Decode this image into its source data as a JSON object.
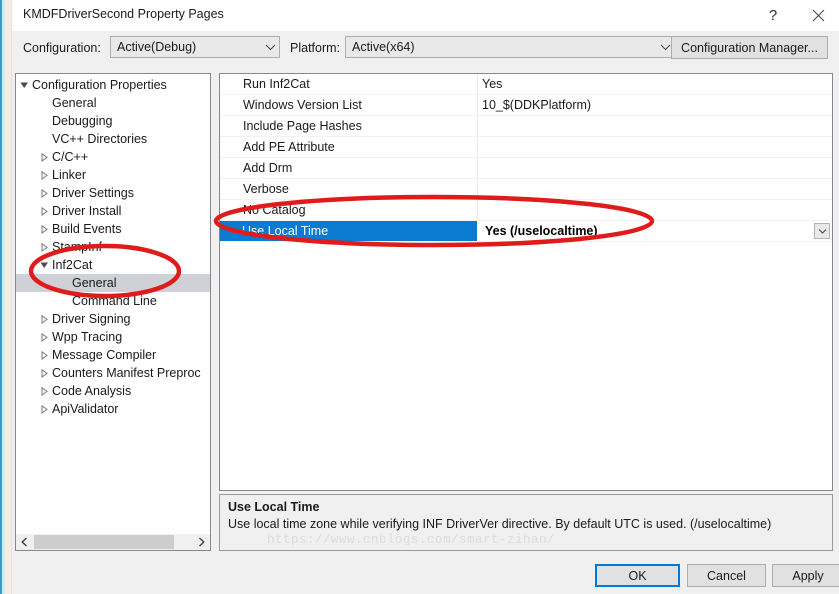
{
  "window": {
    "title": "KMDFDriverSecond Property Pages",
    "help_icon": "question-mark-icon",
    "close_icon": "close-icon"
  },
  "config_bar": {
    "configuration_label": "Configuration:",
    "configuration_value": "Active(Debug)",
    "platform_label": "Platform:",
    "platform_value": "Active(x64)",
    "configuration_manager_button": "Configuration Manager..."
  },
  "tree": {
    "items": [
      {
        "label": "Configuration Properties",
        "indent": 0,
        "toggle": "expanded",
        "selected": false
      },
      {
        "label": "General",
        "indent": 1,
        "toggle": "none",
        "selected": false
      },
      {
        "label": "Debugging",
        "indent": 1,
        "toggle": "none",
        "selected": false
      },
      {
        "label": "VC++ Directories",
        "indent": 1,
        "toggle": "none",
        "selected": false
      },
      {
        "label": "C/C++",
        "indent": 1,
        "toggle": "collapsed",
        "selected": false
      },
      {
        "label": "Linker",
        "indent": 1,
        "toggle": "collapsed",
        "selected": false
      },
      {
        "label": "Driver Settings",
        "indent": 1,
        "toggle": "collapsed",
        "selected": false
      },
      {
        "label": "Driver Install",
        "indent": 1,
        "toggle": "collapsed",
        "selected": false
      },
      {
        "label": "Build Events",
        "indent": 1,
        "toggle": "collapsed",
        "selected": false
      },
      {
        "label": "StampInf",
        "indent": 1,
        "toggle": "collapsed",
        "selected": false
      },
      {
        "label": "Inf2Cat",
        "indent": 1,
        "toggle": "expanded",
        "selected": false
      },
      {
        "label": "General",
        "indent": 2,
        "toggle": "none",
        "selected": true
      },
      {
        "label": "Command Line",
        "indent": 2,
        "toggle": "none",
        "selected": false
      },
      {
        "label": "Driver Signing",
        "indent": 1,
        "toggle": "collapsed",
        "selected": false
      },
      {
        "label": "Wpp Tracing",
        "indent": 1,
        "toggle": "collapsed",
        "selected": false
      },
      {
        "label": "Message Compiler",
        "indent": 1,
        "toggle": "collapsed",
        "selected": false
      },
      {
        "label": "Counters Manifest Preproc",
        "indent": 1,
        "toggle": "collapsed",
        "selected": false
      },
      {
        "label": "Code Analysis",
        "indent": 1,
        "toggle": "collapsed",
        "selected": false
      },
      {
        "label": "ApiValidator",
        "indent": 1,
        "toggle": "collapsed",
        "selected": false
      }
    ],
    "scroll_left_icon": "chevron-left-icon",
    "scroll_right_icon": "chevron-right-icon"
  },
  "property_grid": {
    "rows": [
      {
        "name": "Run Inf2Cat",
        "value": "Yes",
        "selected": false
      },
      {
        "name": "Windows Version List",
        "value": "10_$(DDKPlatform)",
        "selected": false
      },
      {
        "name": "Include Page Hashes",
        "value": "",
        "selected": false
      },
      {
        "name": "Add PE Attribute",
        "value": "",
        "selected": false
      },
      {
        "name": "Add Drm",
        "value": "",
        "selected": false
      },
      {
        "name": "Verbose",
        "value": "",
        "selected": false
      },
      {
        "name": "No Catalog",
        "value": "",
        "selected": false
      },
      {
        "name": "Use Local Time",
        "value": "Yes (/uselocaltime)",
        "selected": true
      }
    ],
    "dropdown_icon": "chevron-down-icon"
  },
  "description": {
    "title": "Use Local Time",
    "body": "Use local time zone while verifying INF DriverVer directive. By default UTC is used.  (/uselocaltime)",
    "watermark": "https://www.cnblogs.com/smart-zihan/"
  },
  "footer": {
    "ok": "OK",
    "cancel": "Cancel",
    "apply": "Apply"
  },
  "colors": {
    "selection_blue": "#0a7bd1",
    "tree_selection_gray": "#cfd1d6",
    "annotation_red": "#e01b1b",
    "focus_border": "#0078d7"
  }
}
